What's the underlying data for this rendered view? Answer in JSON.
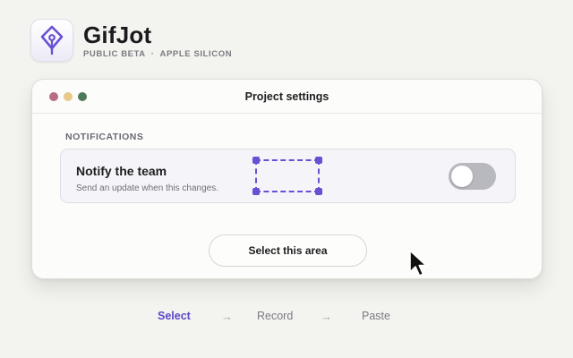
{
  "brand": {
    "name": "GifJot",
    "tagline_left": "PUBLIC BETA",
    "tagline_sep": "·",
    "tagline_right": "APPLE SILICON",
    "icon": "pen-nib-icon",
    "accent_color": "#6a4fd4"
  },
  "window": {
    "title": "Project settings",
    "traffic_lights": [
      "close",
      "minimize",
      "zoom"
    ]
  },
  "notifications": {
    "section_label": "NOTIFICATIONS",
    "setting_title": "Notify the team",
    "setting_description": "Send an update when this changes.",
    "toggle_on": false
  },
  "selection": {
    "button_label": "Select this area"
  },
  "steps": {
    "items": [
      "Select",
      "Record",
      "Paste"
    ],
    "arrow": "→",
    "active_index": 0
  }
}
